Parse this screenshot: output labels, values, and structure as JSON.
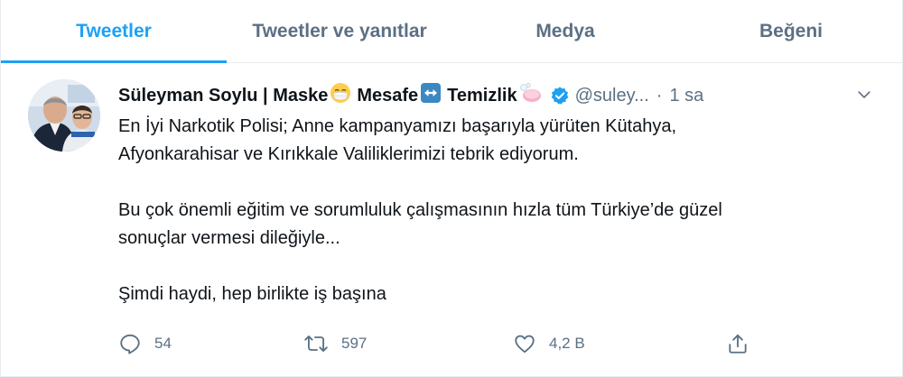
{
  "tabs": [
    {
      "label": "Tweetler",
      "active": true
    },
    {
      "label": "Tweetler ve yanıtlar",
      "active": false
    },
    {
      "label": "Medya",
      "active": false
    },
    {
      "label": "Beğeni",
      "active": false
    }
  ],
  "tweet": {
    "author": {
      "name_part1": "Süleyman Soylu | Maske",
      "name_part2": "Mesafe",
      "name_part3": "Temizlik",
      "handle": "@suley...",
      "verified": true
    },
    "separator": "·",
    "time": "1 sa",
    "text": {
      "para1_line1": "En İyi Narkotik Polisi; Anne kampanyamızı başarıyla yürüten Kütahya,",
      "para1_line2": "Afyonkarahisar ve Kırıkkale Valiliklerimizi tebrik ediyorum.",
      "para2_line1": "Bu çok önemli eğitim ve sorumluluk çalışmasının hızla tüm Türkiye’de güzel",
      "para2_line2": "sonuçlar vermesi dileğiyle...",
      "para3_line1": "Şimdi haydi, hep birlikte iş başına"
    },
    "actions": {
      "reply_count": "54",
      "retweet_count": "597",
      "like_count": "4,2 B"
    }
  },
  "colors": {
    "accent": "#1da1f2",
    "muted": "#5b7083",
    "text": "#0f1419",
    "border": "#e6ecf0"
  },
  "icons": [
    "mask-emoji-icon",
    "left-right-arrow-emoji-icon",
    "soap-emoji-icon",
    "verified-badge-icon",
    "chevron-down-icon",
    "reply-icon",
    "retweet-icon",
    "like-icon",
    "share-icon"
  ]
}
